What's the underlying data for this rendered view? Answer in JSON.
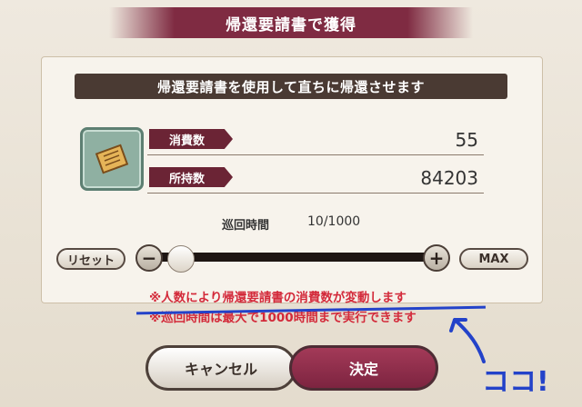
{
  "dialog": {
    "title": "帰還要請書で獲得",
    "instruction": "帰還要請書を使用して直ちに帰還させます"
  },
  "item": {
    "icon": "scroll-icon",
    "consume_label": "消費数",
    "consume_value": "55",
    "owned_label": "所持数",
    "owned_value": "84203"
  },
  "tour": {
    "label": "巡回時間",
    "value": "10/1000"
  },
  "slider": {
    "reset_label": "リセット",
    "minus_label": "−",
    "plus_label": "+",
    "max_label": "MAX",
    "position_fraction": 0.01
  },
  "notes": {
    "line1": "※人数により帰還要請書の消費数が変動します",
    "line2": "※巡回時間は最大で1000時間まで実行できます"
  },
  "buttons": {
    "cancel_label": "キャンセル",
    "ok_label": "決定"
  },
  "annotation": {
    "text": "ココ!",
    "color": "#2342c9"
  },
  "colors": {
    "accent": "#7f2b42",
    "warning": "#d32a3a"
  }
}
